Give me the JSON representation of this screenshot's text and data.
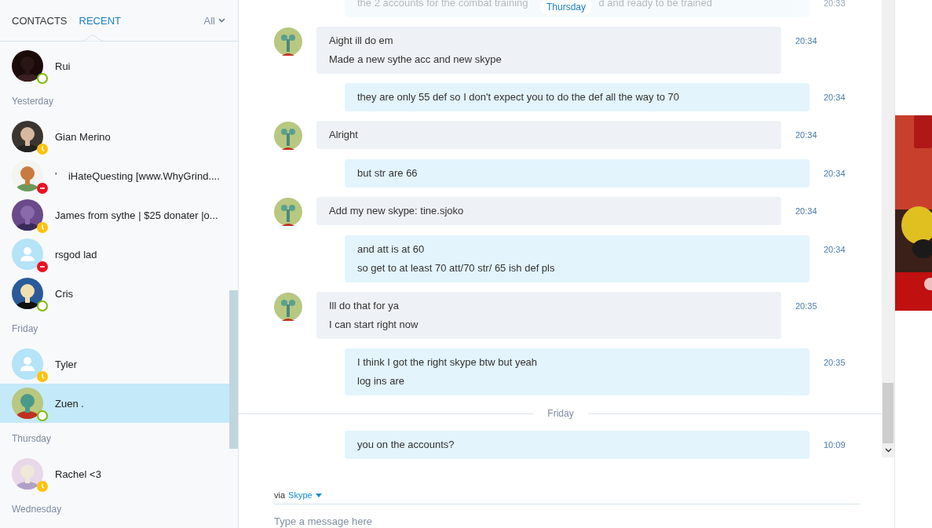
{
  "sidebar": {
    "tabs": [
      {
        "label": "CONTACTS",
        "selected": false
      },
      {
        "label": "RECENT",
        "selected": true
      }
    ],
    "filter": "All",
    "groups": [
      {
        "contacts": [
          {
            "name": "Rui",
            "color": "#7fba00",
            "kind": "picture",
            "selected": false
          }
        ]
      },
      {
        "label": "Yesterday",
        "contacts": [
          {
            "name": "Gian Merino",
            "color": "#fdc30d",
            "kind": "picture",
            "selected": false
          },
          {
            "name": "'    iHateQuesting [www.WhyGrind....",
            "color": "#e81123",
            "kind": "picture",
            "selected": false
          },
          {
            "name": "James from sythe | $25 donater |o...",
            "color": "#fdc30d",
            "kind": "picture",
            "selected": false
          },
          {
            "name": "rsgod lad",
            "color": "#e81123",
            "kind": "default",
            "selected": false
          },
          {
            "name": "Cris",
            "color": "#7fba00",
            "kind": "picture",
            "selected": false
          }
        ]
      },
      {
        "label": "Friday",
        "contacts": [
          {
            "name": "Tyler",
            "color": "#fdc30d",
            "kind": "default",
            "selected": false
          },
          {
            "name": "Zuen .",
            "color": "#7fba00",
            "kind": "picture",
            "selected": true
          }
        ]
      },
      {
        "label": "Thursday",
        "contacts": [
          {
            "name": "Rachel <3",
            "color": "#fdc30d",
            "kind": "picture",
            "selected": false
          }
        ]
      },
      {
        "label": "Wednesday"
      }
    ]
  },
  "chat": {
    "sticky_date": "Thursday",
    "items": [
      {
        "kind": "faded",
        "line_parts": [
          "the 2 accounts for the combat training",
          "d and ready to be trained"
        ],
        "time": "20:33"
      },
      {
        "kind": "received",
        "lines": [
          "Aight ill do em",
          "Made a new sythe acc and new skype"
        ],
        "time": "20:34"
      },
      {
        "kind": "sent",
        "lines": [
          "they are only 55 def so I don't expect you to do the def all the way to 70"
        ],
        "time": "20:34"
      },
      {
        "kind": "received",
        "lines": [
          "Alright"
        ],
        "time": "20:34"
      },
      {
        "kind": "sent",
        "lines": [
          "but str are 66"
        ],
        "time": "20:34"
      },
      {
        "kind": "received",
        "lines": [
          "Add my new skype: tine.sjoko"
        ],
        "time": "20:34"
      },
      {
        "kind": "sent",
        "lines": [
          "and att is at 60",
          "so get to at least 70 att/70 str/ 65 ish def pls"
        ],
        "time": "20:34"
      },
      {
        "kind": "received",
        "lines": [
          "Ill do that for ya",
          "I can start right now"
        ],
        "time": "20:35"
      },
      {
        "kind": "sent",
        "lines": [
          "I think I got the right skype btw but yeah",
          "log ins are"
        ],
        "time": "20:35"
      },
      {
        "kind": "date",
        "label": "Friday"
      },
      {
        "kind": "sent",
        "lines": [
          "you on the accounts?"
        ],
        "time": "10:09"
      }
    ]
  },
  "composer": {
    "via": "via",
    "service": "Skype",
    "placeholder": "Type a message here"
  }
}
